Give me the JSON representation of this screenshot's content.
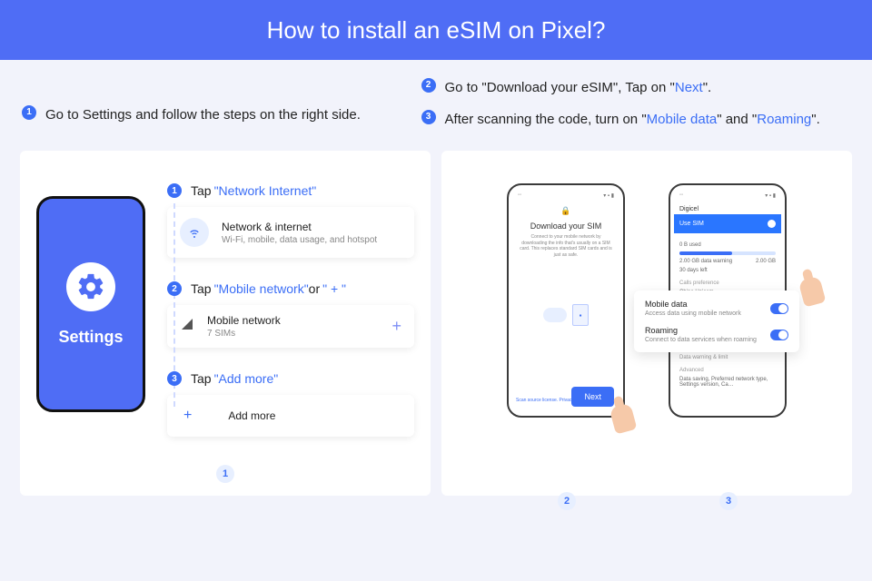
{
  "hero_title": "How to install an eSIM on Pixel?",
  "top_instructions": {
    "left": {
      "num": "1",
      "text": "Go to Settings and follow the steps on the right side."
    },
    "right": [
      {
        "num": "2",
        "pre": "Go to \"Download your eSIM\", Tap on \"",
        "hl": "Next",
        "post": "\"."
      },
      {
        "num": "3",
        "pre": "After scanning the code, turn on \"",
        "hl1": "Mobile data",
        "mid": "\" and \"",
        "hl2": "Roaming",
        "post": "\"."
      }
    ]
  },
  "left_panel": {
    "phone_label": "Settings",
    "steps": [
      {
        "num": "1",
        "lead": "Tap ",
        "hl": "\"Network Internet\"",
        "card": {
          "title": "Network & internet",
          "sub": "Wi-Fi, mobile, data usage, and hotspot"
        }
      },
      {
        "num": "2",
        "lead": "Tap ",
        "hl": "\"Mobile network\"",
        "mid": " or ",
        "hl2": "\" + \"",
        "card": {
          "title": "Mobile network",
          "sub": "7 SIMs"
        }
      },
      {
        "num": "3",
        "lead": "Tap ",
        "hl": "\"Add more\"",
        "card": {
          "title": "Add more"
        }
      }
    ],
    "bottom_badge": "1"
  },
  "right_panel": {
    "phone2": {
      "title": "Download your SIM",
      "desc": "Connect to your mobile network by downloading the info that's usually on a SIM card. This replaces standard SIM cards and is just as safe.",
      "scan_link": "Scan source license. Privacy po…",
      "next_label": "Next"
    },
    "phone3": {
      "carrier": "Digicel",
      "use_sim": "Use SIM",
      "used": "0 B used",
      "warn": "2.00 GB data warning",
      "days": "30 days left",
      "limit": "2.00 GB",
      "calls_pref": "Calls preference",
      "calls_sub": "China Unicom",
      "data_warn": "Data warning & limit",
      "adv": "Advanced",
      "adv_sub": "Data saving, Preferred network type, Settings version, Ca…"
    },
    "overlay": {
      "mobile_data": {
        "title": "Mobile data",
        "sub": "Access data using mobile network"
      },
      "roaming": {
        "title": "Roaming",
        "sub": "Connect to data services when roaming"
      }
    },
    "bottom_badge_2": "2",
    "bottom_badge_3": "3"
  }
}
